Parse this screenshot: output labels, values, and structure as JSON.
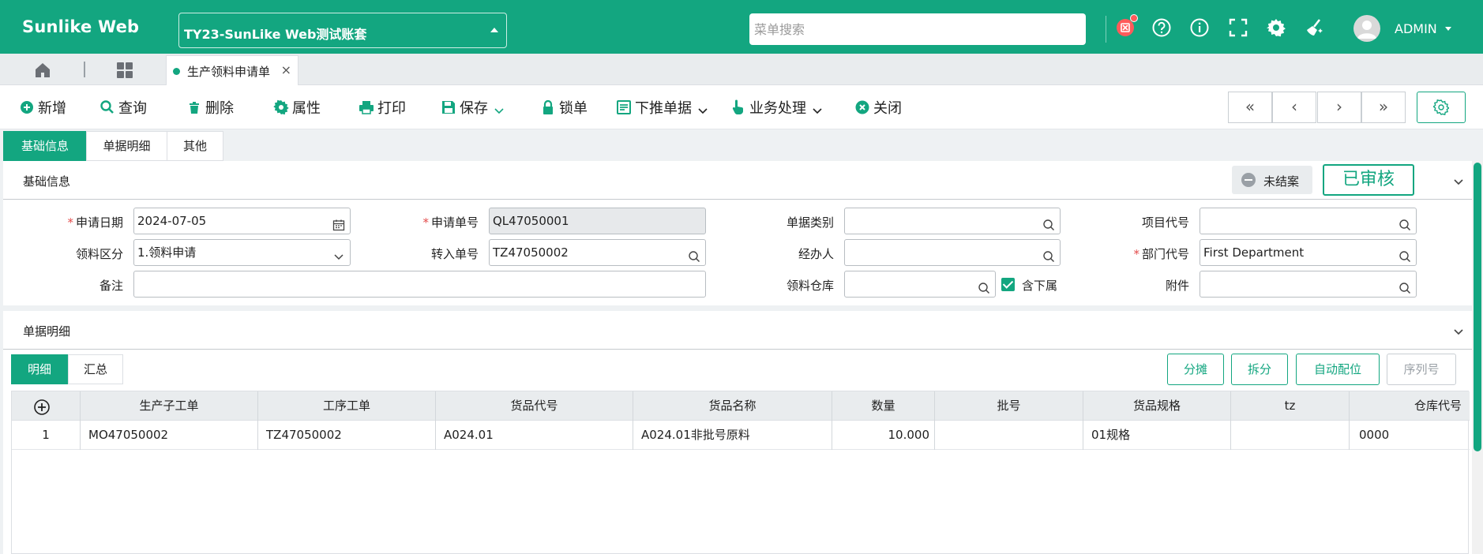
{
  "app": {
    "brand": "Sunlike Web",
    "account": "TY23-SunLike Web测试账套",
    "search_placeholder": "菜单搜索",
    "user": "ADMIN"
  },
  "tabs": {
    "page_tab": "生产领料申请单"
  },
  "toolbar": {
    "new": "新增",
    "query": "查询",
    "delete": "删除",
    "properties": "属性",
    "print": "打印",
    "save": "保存",
    "lock": "锁单",
    "push_down": "下推单据",
    "business": "业务处理",
    "close": "关闭",
    "nav": [
      "«",
      "‹",
      "›",
      "»"
    ]
  },
  "section_tabs": [
    "基础信息",
    "单据明细",
    "其他"
  ],
  "basic": {
    "title": "基础信息",
    "status_unclosed": "未结案",
    "status_audited": "已审核",
    "fields": {
      "apply_date": {
        "label": "申请日期",
        "value": "2024-07-05"
      },
      "apply_no": {
        "label": "申请单号",
        "value": "QL47050001"
      },
      "doc_type": {
        "label": "单据类别",
        "value": ""
      },
      "project_code": {
        "label": "项目代号",
        "value": ""
      },
      "pick_type": {
        "label": "领料区分",
        "value": "1.领料申请"
      },
      "transfer_no": {
        "label": "转入单号",
        "value": "TZ47050002"
      },
      "handler": {
        "label": "经办人",
        "value": ""
      },
      "dept_code": {
        "label": "部门代号",
        "value": "First Department"
      },
      "remark": {
        "label": "备注",
        "value": ""
      },
      "warehouse": {
        "label": "领料仓库",
        "value": ""
      },
      "include_sub": {
        "label": "含下属",
        "checked": true
      },
      "attachment": {
        "label": "附件",
        "value": ""
      }
    }
  },
  "detail": {
    "title": "单据明细",
    "subtabs": [
      "明细",
      "汇总"
    ],
    "buttons": [
      "分摊",
      "拆分",
      "自动配位",
      "序列号"
    ],
    "columns": [
      "生产子工单",
      "工序工单",
      "货品代号",
      "货品名称",
      "数量",
      "批号",
      "货品规格",
      "tz",
      "仓库代号"
    ],
    "rows": [
      {
        "no": "1",
        "cells": [
          "MO47050002",
          "TZ47050002",
          "A024.01",
          "A024.01非批号原料",
          "10.000",
          "",
          "01规格",
          "",
          "0000"
        ]
      }
    ]
  },
  "colors": {
    "accent": "#13a680",
    "required": "#e34b4b"
  },
  "icons": [
    "notification-icon",
    "help-icon",
    "info-icon",
    "fullscreen-icon",
    "settings-icon",
    "clean-icon",
    "avatar-icon"
  ]
}
